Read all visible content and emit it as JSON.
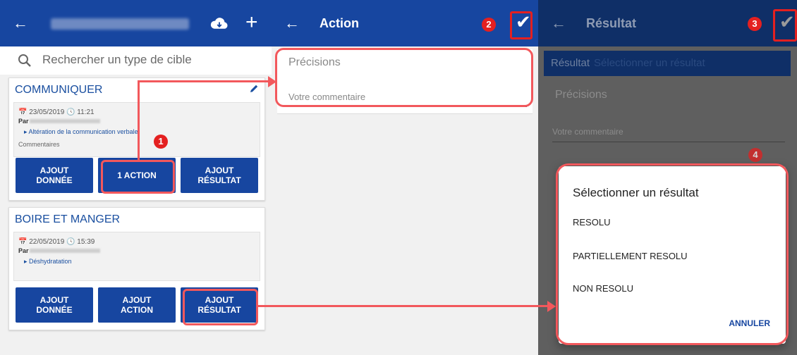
{
  "panel1": {
    "back_icon": "arrow-left",
    "cloud_icon": "cloud-download",
    "add_icon": "plus",
    "search_placeholder": "Rechercher un type de cible",
    "cards": [
      {
        "title": "COMMUNIQUER",
        "datetime": "📅 23/05/2019  🕓 11:21",
        "par": "Par",
        "diagnosis": "▸ Altération de la communication verbale",
        "comments": "Commentaires",
        "buttons": [
          "AJOUT\nDONNÉE",
          "1 ACTION",
          "AJOUT\nRÉSULTAT"
        ]
      },
      {
        "title": "BOIRE ET MANGER",
        "datetime": "📅 22/05/2019  🕓 15:39",
        "par": "Par",
        "diagnosis": "▸ Déshydratation",
        "buttons": [
          "AJOUT\nDONNÉE",
          "AJOUT\nACTION",
          "AJOUT\nRÉSULTAT"
        ]
      }
    ]
  },
  "panel2": {
    "title": "Action",
    "precisions_label": "Précisions",
    "comment_placeholder": "Votre commentaire"
  },
  "panel3": {
    "title": "Résultat",
    "result_label": "Résultat",
    "result_placeholder": "Sélectionner un résultat",
    "precisions_label": "Précisions",
    "comment_placeholder": "Votre commentaire"
  },
  "dialog": {
    "title": "Sélectionner un résultat",
    "options": [
      "RESOLU",
      "PARTIELLEMENT RESOLU",
      "NON RESOLU"
    ],
    "cancel": "ANNULER"
  },
  "markers": [
    "1",
    "2",
    "3",
    "4"
  ],
  "colors": {
    "primary": "#1746a0",
    "highlight": "#f2585c",
    "marker": "#e42020",
    "overlay": "#5f5f5f"
  }
}
